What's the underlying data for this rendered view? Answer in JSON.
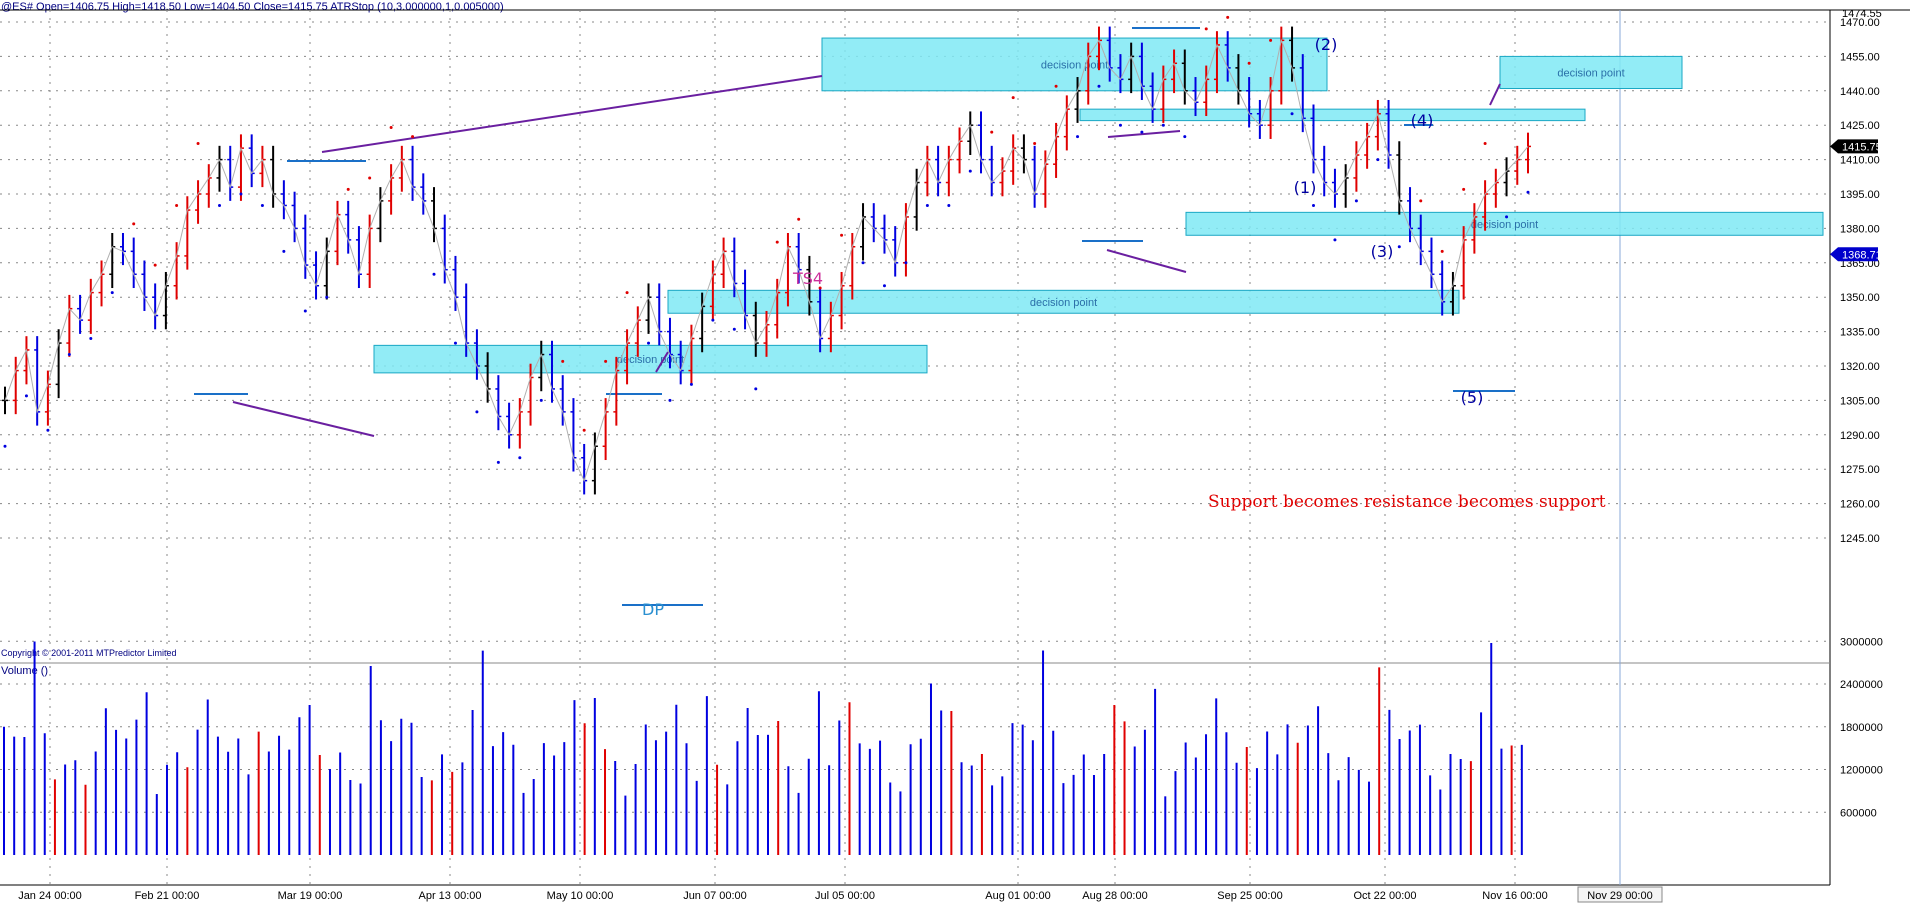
{
  "header": {
    "title": "@ES#  Open=1406.75  High=1418.50  Low=1404.50  Close=1415.75  ATRStop (10,3.000000,1,0.005000)"
  },
  "copyright": "Copyright © 2001-2011 MTPredictor Limited",
  "volume_title": "Volume ()",
  "callout": "Support becomes resistance becomes support",
  "colors": {
    "up_bar": "#e00000",
    "down_bar": "#0000e0",
    "neutral_bar": "#000000",
    "zone_fill": "#7fe9f5",
    "zone_stroke": "#1aa7c4",
    "trendline": "#6a1fa0",
    "grid": "#888888",
    "axis_text": "#000000"
  },
  "chart_data": [
    {
      "type": "candlestick",
      "title": "@ES#",
      "y_ticks": [
        "1245.00",
        "1260.00",
        "1275.00",
        "1290.00",
        "1305.00",
        "1320.00",
        "1335.00",
        "1350.00",
        "1365.00",
        "1380.00",
        "1395.00",
        "1410.00",
        "1425.00",
        "1440.00",
        "1455.00",
        "1470.00"
      ],
      "ylim": [
        1238,
        1478
      ],
      "x_ticks": [
        "Jan 24 00:00",
        "Feb 21 00:00",
        "Mar 19 00:00",
        "Apr 13 00:00",
        "May 10 00:00",
        "Jun 07 00:00",
        "Jul 05 00:00",
        "Aug 01 00:00",
        "Aug 28 00:00",
        "Sep 25 00:00",
        "Oct 22 00:00",
        "Nov 16 00:00"
      ],
      "x_cursor_label": "Nov 29 00:00",
      "top_axis_label": "1474.55",
      "last_price_label": "1415.75",
      "atr_stop_label": "1368.71",
      "grid": true,
      "close_path": [
        1305,
        1318,
        1327,
        1300,
        1312,
        1330,
        1345,
        1340,
        1352,
        1360,
        1372,
        1370,
        1360,
        1350,
        1342,
        1355,
        1368,
        1388,
        1395,
        1402,
        1410,
        1398,
        1415,
        1404,
        1410,
        1395,
        1390,
        1380,
        1364,
        1355,
        1370,
        1386,
        1375,
        1360,
        1380,
        1392,
        1402,
        1410,
        1398,
        1392,
        1380,
        1362,
        1350,
        1330,
        1320,
        1310,
        1298,
        1290,
        1300,
        1315,
        1325,
        1310,
        1300,
        1280,
        1270,
        1285,
        1300,
        1318,
        1330,
        1340,
        1350,
        1335,
        1325,
        1318,
        1332,
        1346,
        1360,
        1370,
        1356,
        1342,
        1330,
        1338,
        1352,
        1372,
        1362,
        1348,
        1332,
        1342,
        1355,
        1372,
        1385,
        1380,
        1375,
        1365,
        1385,
        1400,
        1410,
        1400,
        1410,
        1418,
        1425,
        1410,
        1400,
        1405,
        1415,
        1410,
        1395,
        1408,
        1420,
        1432,
        1440,
        1455,
        1462,
        1450,
        1445,
        1455,
        1442,
        1432,
        1445,
        1452,
        1440,
        1435,
        1445,
        1460,
        1450,
        1440,
        1430,
        1425,
        1440,
        1462,
        1450,
        1428,
        1410,
        1400,
        1395,
        1402,
        1412,
        1420,
        1430,
        1412,
        1392,
        1380,
        1370,
        1360,
        1348,
        1355,
        1375,
        1385,
        1395,
        1400,
        1405,
        1410,
        1415.75
      ],
      "annotations": [
        "decision point",
        "decision point",
        "decision point",
        "decision point",
        "decision point",
        "decision point",
        "TS4",
        "DP",
        "(1)",
        "(2)",
        "(3)",
        "(4)",
        "(5)"
      ],
      "zones": [
        {
          "label": "decision point",
          "low": 1440,
          "high": 1463
        },
        {
          "label": "decision point",
          "low": 1441,
          "high": 1455
        },
        {
          "label": "",
          "low": 1427,
          "high": 1432
        },
        {
          "label": "decision point",
          "low": 1377,
          "high": 1387
        },
        {
          "label": "decision point",
          "low": 1343,
          "high": 1353
        },
        {
          "label": "decision point",
          "low": 1317,
          "high": 1329
        }
      ]
    },
    {
      "type": "bar",
      "title": "Volume ()",
      "y_ticks": [
        "600000",
        "1200000",
        "1800000",
        "2400000",
        "3000000"
      ],
      "ylim": [
        0,
        3300000
      ]
    }
  ]
}
